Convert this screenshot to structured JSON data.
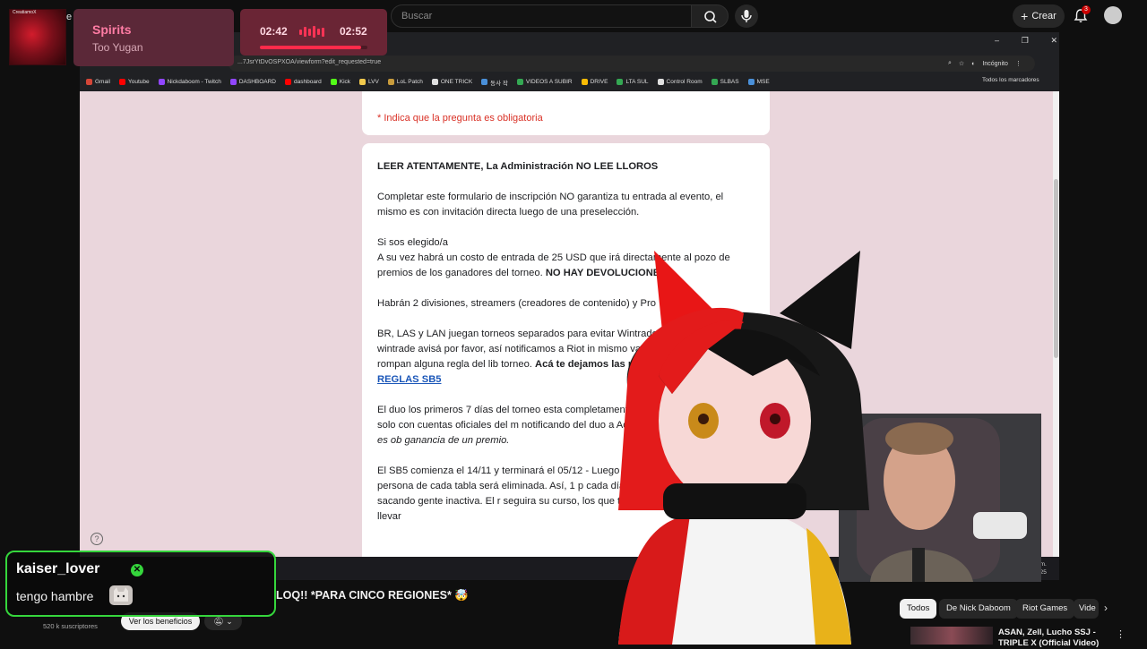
{
  "youtube": {
    "search_placeholder": "Buscar",
    "create_label": "Crear",
    "notification_count": "3"
  },
  "music": {
    "album_label": "CreatiamoX",
    "channel_letter": "e",
    "title": "Spirits",
    "artist": "Too Yugan",
    "elapsed": "02:42",
    "total": "02:52",
    "progress": 0.94
  },
  "browser": {
    "url": "...7JsrYtDvOSPXOA/viewform?edit_requested=true",
    "incognito_label": "Incógnito",
    "all_bookmarks": "Todos los marcadores",
    "bookmarks": [
      {
        "label": "Gmail",
        "color": "#d44638"
      },
      {
        "label": "Youtube",
        "color": "#ff0000"
      },
      {
        "label": "Nickdaboom - Twitch",
        "color": "#9146ff"
      },
      {
        "label": "DASHBOARD",
        "color": "#9146ff"
      },
      {
        "label": "dashboard",
        "color": "#ff0000"
      },
      {
        "label": "Kick",
        "color": "#53fc18"
      },
      {
        "label": "LVV",
        "color": "#f2c94c"
      },
      {
        "label": "LoL Patch",
        "color": "#c89b3c"
      },
      {
        "label": "ONE TRICK",
        "color": "#e0e0e0"
      },
      {
        "label": "동사 작",
        "color": "#4a90d9"
      },
      {
        "label": "VIDEOS A SUBIR",
        "color": "#34a853"
      },
      {
        "label": "DRIVE",
        "color": "#fbbc04"
      },
      {
        "label": "LTA SUL",
        "color": "#34a853"
      },
      {
        "label": "Control Room",
        "color": "#e0e0e0"
      },
      {
        "label": "SLBAS",
        "color": "#34a853"
      },
      {
        "label": "MSE",
        "color": "#4a90d9"
      }
    ],
    "clock": "9 a. m.\n0/2025"
  },
  "form": {
    "required_note": "* Indica que la pregunta es obligatoria",
    "heading": "LEER ATENTAMENTE,  La Administración NO LEE LLOROS",
    "p1": "Completar este formulario de inscripción NO garantiza tu entrada al evento, el mismo es con invitación directa luego de una preselección.",
    "p2_line1": "Si sos elegido/a",
    "p2_line2": "A su vez habrá un costo de entrada de 25 USD que irá directamente al pozo de premios de los ganadores del torneo.",
    "p2_bold": "NO HAY DEVOLUCIONES",
    "p3": "Habrán 2 divisiones, streamers (creadores de contenido) y Pro",
    "p4": "BR, LAS y LAN juegan torneos separados para evitar Wintrades alguien hace wintrade avisá por favor, así notificamos a Riot in mismo va para participantes que rompan alguna regla del lib torneo.",
    "p4_bold": "Acá te dejamos las reglas!",
    "p4_link": "LIBRO DE REGLAS SB5",
    "p5": "El duo los primeros 7 días del torneo esta completamente participantes del torneo y solo con cuentas oficiales del m notificando del duo a Administración,",
    "p5_italic": "jugar duo no es ob ganancia de un premio.",
    "p6": "El SB5 comienza el 14/11 y terminará el 05/12 - Luego de 24 h torneo, la última persona de cada tabla será eliminada. Así, 1 p cada día será expulsada del torneo, sacando gente inactiva. El r seguira su curso, los que tengan mas LP al finalizar se llevar"
  },
  "video": {
    "title": "LOQ!! *PARA CINCO REGIONES* 🤯",
    "subscribers": "520 k suscriptores",
    "benefits_label": "Ver los beneficios"
  },
  "chips": [
    "Todos",
    "De Nick Daboom",
    "Riot Games",
    "Vide"
  ],
  "related": {
    "title": "ASAN, Zell, Lucho SSJ - TRIPLE X (Official Video)"
  },
  "chat": {
    "username": "kaiser_lover",
    "message": "tengo hambre"
  },
  "colors": {
    "accent_green": "#35d63c",
    "music_pink": "#ff7ca4",
    "form_bg": "#ead6dc"
  }
}
